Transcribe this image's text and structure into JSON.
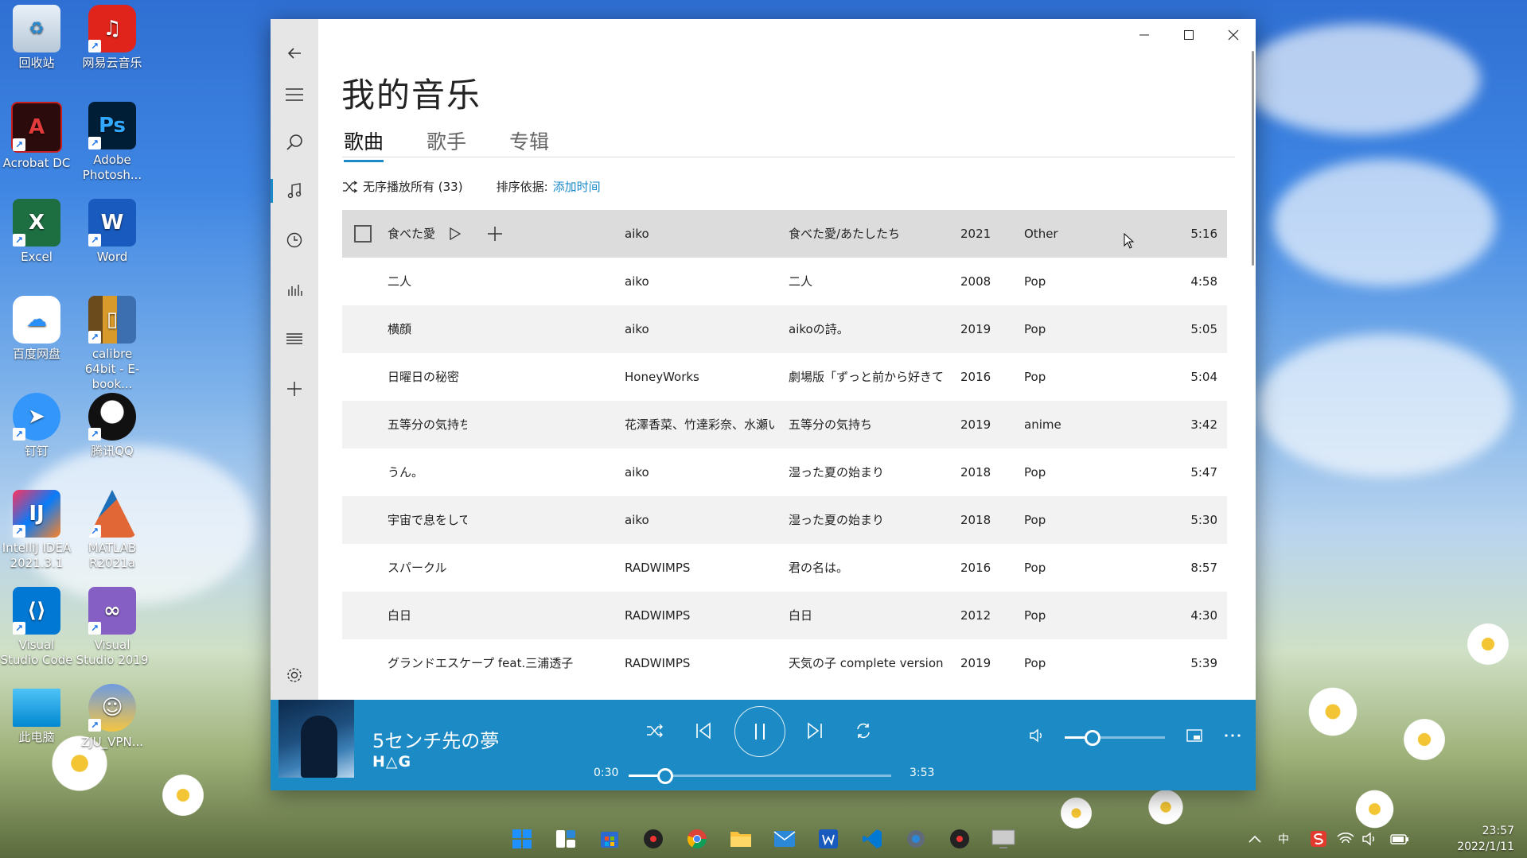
{
  "desktop": {
    "icons": [
      {
        "label": "回收站"
      },
      {
        "label": "网易云音乐"
      },
      {
        "label": "Acrobat DC"
      },
      {
        "label": "Adobe Photosh..."
      },
      {
        "label": "Excel"
      },
      {
        "label": "Word"
      },
      {
        "label": "百度网盘"
      },
      {
        "label": "calibre 64bit - E-book..."
      },
      {
        "label": "钉钉"
      },
      {
        "label": "腾讯QQ"
      },
      {
        "label": "IntelliJ IDEA 2021.3.1"
      },
      {
        "label": "MATLAB R2021a"
      },
      {
        "label": "Visual Studio Code"
      },
      {
        "label": "Visual Studio 2019"
      },
      {
        "label": "此电脑"
      },
      {
        "label": "ZJU_VPN..."
      }
    ]
  },
  "app": {
    "title": "我的音乐",
    "tabs": [
      {
        "label": "歌曲",
        "active": true
      },
      {
        "label": "歌手",
        "active": false
      },
      {
        "label": "专辑",
        "active": false
      }
    ],
    "shuffle_all": "无序播放所有 (33)",
    "sort_by_label": "排序依据:",
    "sort_by_value": "添加时间",
    "songs": [
      {
        "title": "食べた愛",
        "artist": "aiko",
        "album": "食べた愛/あたしたち",
        "year": "2021",
        "genre": "Other",
        "duration": "5:16"
      },
      {
        "title": "二人",
        "artist": "aiko",
        "album": "二人",
        "year": "2008",
        "genre": "Pop",
        "duration": "4:58"
      },
      {
        "title": "横顔",
        "artist": "aiko",
        "album": "aikoの詩。",
        "year": "2019",
        "genre": "Pop",
        "duration": "5:05"
      },
      {
        "title": "日曜日の秘密",
        "artist": "HoneyWorks",
        "album": "劇場版「ずっと前から好きて",
        "year": "2016",
        "genre": "Pop",
        "duration": "5:04"
      },
      {
        "title": "五等分の気持ち",
        "artist": "花澤香菜、竹達彩奈、水瀬い",
        "album": "五等分の気持ち",
        "year": "2019",
        "genre": "anime",
        "duration": "3:42"
      },
      {
        "title": "うん。",
        "artist": "aiko",
        "album": "湿った夏の始まり",
        "year": "2018",
        "genre": "Pop",
        "duration": "5:47"
      },
      {
        "title": "宇宙で息をして",
        "artist": "aiko",
        "album": "湿った夏の始まり",
        "year": "2018",
        "genre": "Pop",
        "duration": "5:30"
      },
      {
        "title": "スパークル",
        "artist": "RADWIMPS",
        "album": "君の名は。",
        "year": "2016",
        "genre": "Pop",
        "duration": "8:57"
      },
      {
        "title": "白日",
        "artist": "RADWIMPS",
        "album": "白日",
        "year": "2012",
        "genre": "Pop",
        "duration": "4:30"
      },
      {
        "title": "グランドエスケープ feat.三浦透子",
        "artist": "RADWIMPS",
        "album": "天気の子 complete version",
        "year": "2019",
        "genre": "Pop",
        "duration": "5:39"
      }
    ]
  },
  "player": {
    "song_title": "5センチ先の夢",
    "artist": "H△G",
    "current_time": "0:30",
    "total_time": "3:53",
    "progress_fraction": 0.13,
    "volume_fraction": 0.25
  },
  "tray": {
    "ime": "中",
    "time": "23:57",
    "date": "2022/1/11"
  },
  "colors": {
    "accent": "#1c8ac4",
    "accent_link": "#1a8ac8"
  }
}
